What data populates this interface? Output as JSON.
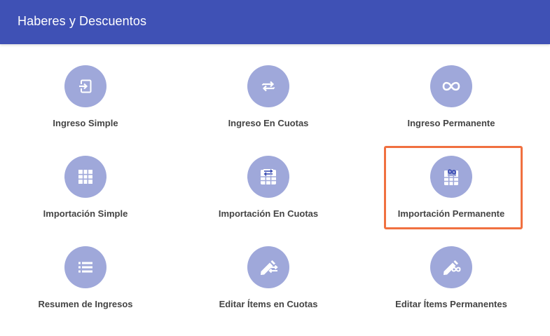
{
  "header": {
    "title": "Haberes y Descuentos"
  },
  "tiles": [
    {
      "label": "Ingreso Simple",
      "icon": "enter-icon"
    },
    {
      "label": "Ingreso En Cuotas",
      "icon": "swap-arrows-icon"
    },
    {
      "label": "Ingreso Permanente",
      "icon": "infinity-icon"
    },
    {
      "label": "Importación Simple",
      "icon": "grid-icon"
    },
    {
      "label": "Importación En Cuotas",
      "icon": "grid-swap-icon"
    },
    {
      "label": "Importación Permanente",
      "icon": "grid-infinity-icon"
    },
    {
      "label": "Resumen de Ingresos",
      "icon": "list-icon"
    },
    {
      "label": "Editar Ítems en Cuotas",
      "icon": "edit-swap-icon"
    },
    {
      "label": "Editar Ítems Permanentes",
      "icon": "edit-infinity-icon"
    }
  ],
  "selected_tile": "Importación Permanente",
  "colors": {
    "header": "#3f51b5",
    "icon_circle": "#9fa8da",
    "highlight": "#f07040"
  }
}
